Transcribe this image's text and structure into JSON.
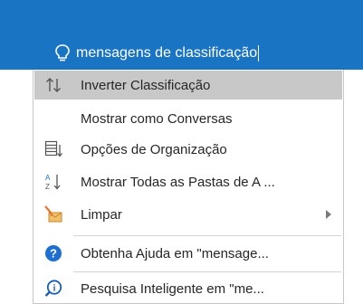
{
  "search": {
    "icon": "lightbulb-icon",
    "query": "mensagens de classificação"
  },
  "menu": {
    "items": [
      {
        "label": "Inverter Classificação",
        "icon": "sort-arrows-icon",
        "selected": true
      },
      {
        "label": "Mostrar como Conversas",
        "icon": "",
        "selected": false
      },
      {
        "label": "Opções de Organização",
        "icon": "arrange-options-icon",
        "selected": false
      },
      {
        "label": "Mostrar Todas as Pastas de A ...",
        "icon": "sort-a-z-icon",
        "selected": false
      },
      {
        "label": "Limpar",
        "icon": "clean-up-icon",
        "selected": false,
        "submenu": true
      },
      {
        "label": "Obtenha Ajuda em \"mensage...",
        "icon": "help-icon",
        "selected": false
      },
      {
        "label": "Pesquisa Inteligente em \"me...",
        "icon": "smart-lookup-icon",
        "selected": false
      }
    ]
  },
  "colors": {
    "title_bar": "#1a74c4",
    "selected_row": "#c8c8c8",
    "help_blue": "#1e6fcf",
    "smart_lookup_blue": "#1a5fb4",
    "clean_up_orange": "#e8732a"
  }
}
